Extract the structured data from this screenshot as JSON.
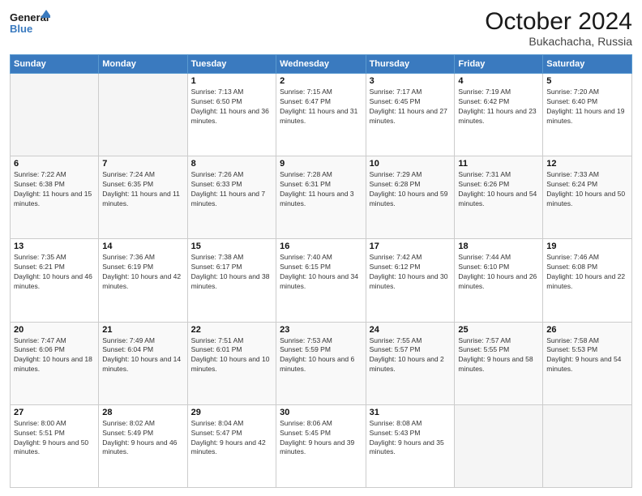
{
  "header": {
    "logo_line1": "General",
    "logo_line2": "Blue",
    "month": "October 2024",
    "location": "Bukachacha, Russia"
  },
  "weekdays": [
    "Sunday",
    "Monday",
    "Tuesday",
    "Wednesday",
    "Thursday",
    "Friday",
    "Saturday"
  ],
  "weeks": [
    [
      {
        "day": "",
        "info": ""
      },
      {
        "day": "",
        "info": ""
      },
      {
        "day": "1",
        "info": "Sunrise: 7:13 AM\nSunset: 6:50 PM\nDaylight: 11 hours and 36 minutes."
      },
      {
        "day": "2",
        "info": "Sunrise: 7:15 AM\nSunset: 6:47 PM\nDaylight: 11 hours and 31 minutes."
      },
      {
        "day": "3",
        "info": "Sunrise: 7:17 AM\nSunset: 6:45 PM\nDaylight: 11 hours and 27 minutes."
      },
      {
        "day": "4",
        "info": "Sunrise: 7:19 AM\nSunset: 6:42 PM\nDaylight: 11 hours and 23 minutes."
      },
      {
        "day": "5",
        "info": "Sunrise: 7:20 AM\nSunset: 6:40 PM\nDaylight: 11 hours and 19 minutes."
      }
    ],
    [
      {
        "day": "6",
        "info": "Sunrise: 7:22 AM\nSunset: 6:38 PM\nDaylight: 11 hours and 15 minutes."
      },
      {
        "day": "7",
        "info": "Sunrise: 7:24 AM\nSunset: 6:35 PM\nDaylight: 11 hours and 11 minutes."
      },
      {
        "day": "8",
        "info": "Sunrise: 7:26 AM\nSunset: 6:33 PM\nDaylight: 11 hours and 7 minutes."
      },
      {
        "day": "9",
        "info": "Sunrise: 7:28 AM\nSunset: 6:31 PM\nDaylight: 11 hours and 3 minutes."
      },
      {
        "day": "10",
        "info": "Sunrise: 7:29 AM\nSunset: 6:28 PM\nDaylight: 10 hours and 59 minutes."
      },
      {
        "day": "11",
        "info": "Sunrise: 7:31 AM\nSunset: 6:26 PM\nDaylight: 10 hours and 54 minutes."
      },
      {
        "day": "12",
        "info": "Sunrise: 7:33 AM\nSunset: 6:24 PM\nDaylight: 10 hours and 50 minutes."
      }
    ],
    [
      {
        "day": "13",
        "info": "Sunrise: 7:35 AM\nSunset: 6:21 PM\nDaylight: 10 hours and 46 minutes."
      },
      {
        "day": "14",
        "info": "Sunrise: 7:36 AM\nSunset: 6:19 PM\nDaylight: 10 hours and 42 minutes."
      },
      {
        "day": "15",
        "info": "Sunrise: 7:38 AM\nSunset: 6:17 PM\nDaylight: 10 hours and 38 minutes."
      },
      {
        "day": "16",
        "info": "Sunrise: 7:40 AM\nSunset: 6:15 PM\nDaylight: 10 hours and 34 minutes."
      },
      {
        "day": "17",
        "info": "Sunrise: 7:42 AM\nSunset: 6:12 PM\nDaylight: 10 hours and 30 minutes."
      },
      {
        "day": "18",
        "info": "Sunrise: 7:44 AM\nSunset: 6:10 PM\nDaylight: 10 hours and 26 minutes."
      },
      {
        "day": "19",
        "info": "Sunrise: 7:46 AM\nSunset: 6:08 PM\nDaylight: 10 hours and 22 minutes."
      }
    ],
    [
      {
        "day": "20",
        "info": "Sunrise: 7:47 AM\nSunset: 6:06 PM\nDaylight: 10 hours and 18 minutes."
      },
      {
        "day": "21",
        "info": "Sunrise: 7:49 AM\nSunset: 6:04 PM\nDaylight: 10 hours and 14 minutes."
      },
      {
        "day": "22",
        "info": "Sunrise: 7:51 AM\nSunset: 6:01 PM\nDaylight: 10 hours and 10 minutes."
      },
      {
        "day": "23",
        "info": "Sunrise: 7:53 AM\nSunset: 5:59 PM\nDaylight: 10 hours and 6 minutes."
      },
      {
        "day": "24",
        "info": "Sunrise: 7:55 AM\nSunset: 5:57 PM\nDaylight: 10 hours and 2 minutes."
      },
      {
        "day": "25",
        "info": "Sunrise: 7:57 AM\nSunset: 5:55 PM\nDaylight: 9 hours and 58 minutes."
      },
      {
        "day": "26",
        "info": "Sunrise: 7:58 AM\nSunset: 5:53 PM\nDaylight: 9 hours and 54 minutes."
      }
    ],
    [
      {
        "day": "27",
        "info": "Sunrise: 8:00 AM\nSunset: 5:51 PM\nDaylight: 9 hours and 50 minutes."
      },
      {
        "day": "28",
        "info": "Sunrise: 8:02 AM\nSunset: 5:49 PM\nDaylight: 9 hours and 46 minutes."
      },
      {
        "day": "29",
        "info": "Sunrise: 8:04 AM\nSunset: 5:47 PM\nDaylight: 9 hours and 42 minutes."
      },
      {
        "day": "30",
        "info": "Sunrise: 8:06 AM\nSunset: 5:45 PM\nDaylight: 9 hours and 39 minutes."
      },
      {
        "day": "31",
        "info": "Sunrise: 8:08 AM\nSunset: 5:43 PM\nDaylight: 9 hours and 35 minutes."
      },
      {
        "day": "",
        "info": ""
      },
      {
        "day": "",
        "info": ""
      }
    ]
  ]
}
